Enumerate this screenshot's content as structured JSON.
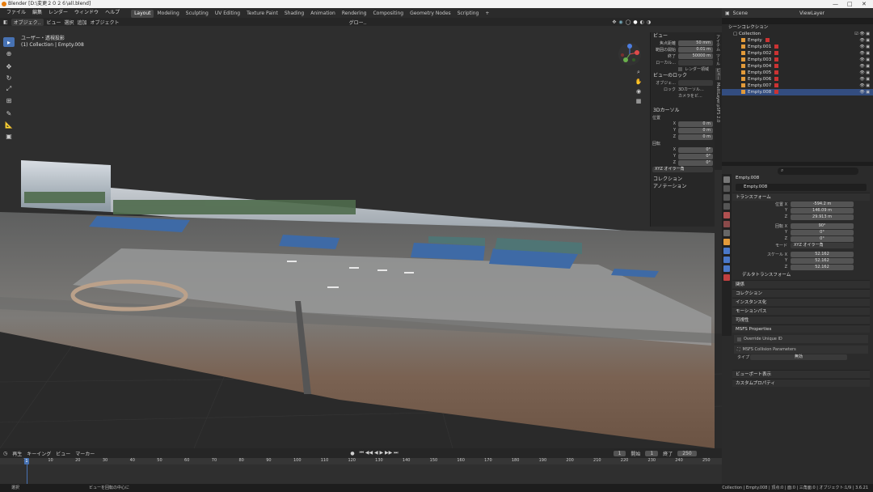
{
  "titlebar": {
    "title": "Blender [D:\\変更２０２６\\all.blend]",
    "min": "—",
    "max": "□",
    "close": "✕"
  },
  "menu": [
    "ファイル",
    "編集",
    "レンダー",
    "ウィンドウ",
    "ヘルプ"
  ],
  "workspaces": [
    {
      "label": "Layout",
      "active": true
    },
    {
      "label": "Modeling"
    },
    {
      "label": "Sculpting"
    },
    {
      "label": "UV Editing"
    },
    {
      "label": "Texture Paint"
    },
    {
      "label": "Shading"
    },
    {
      "label": "Animation"
    },
    {
      "label": "Rendering"
    },
    {
      "label": "Compositing"
    },
    {
      "label": "Geometry Nodes"
    },
    {
      "label": "Scripting"
    },
    {
      "label": "+"
    }
  ],
  "vpheader": {
    "mode": "オブジェク..",
    "items": [
      "ビュー",
      "選択",
      "追加",
      "オブジェクト"
    ],
    "transform": "グロー..",
    "options": "オプション"
  },
  "overlay": {
    "line1": "ユーザー・透視投影",
    "line2": "(1) Collection | Empty.008"
  },
  "npanel": {
    "view_header": "ビュー",
    "focal_label": "焦点距離",
    "focal": "50 mm",
    "clip_start_label": "範囲の開始",
    "clip_start": "0.01 m",
    "clip_end_label": "終了",
    "clip_end": "50000 m",
    "local_label": "ローカル...",
    "render_region": "レンダー領域",
    "lock_header": "ビューのロック",
    "object_label": "オブジェ...",
    "lock_label": "ロック",
    "lock_3d": "3Dカーソル...",
    "lock_cam": "カメラをビ...",
    "cursor_header": "3Dカーソル",
    "location_label": "位置",
    "rotation_label": "回転",
    "x": "X",
    "y": "Y",
    "z": "Z",
    "loc_x": "0 m",
    "loc_y": "0 m",
    "loc_z": "0 m",
    "rot_x": "0°",
    "rot_y": "0°",
    "rot_z": "0°",
    "rot_mode": "XYZ オイラー角",
    "collection": "コレクション",
    "annotation": "アノテーション"
  },
  "sidetabs": [
    "アイテム",
    "ツール",
    "ビュー",
    "MultiLayer.pSFS 2.0"
  ],
  "outliner": {
    "scene": "Scene",
    "viewlayer": "ViewLayer",
    "root": "シーンコレクション",
    "collection": "Collection",
    "items": [
      "Empty",
      "Empty.001",
      "Empty.002",
      "Empty.003",
      "Empty.004",
      "Empty.005",
      "Empty.006",
      "Empty.007",
      "Empty.008"
    ],
    "selected_index": 8
  },
  "props": {
    "object_name": "Empty.008",
    "object_field": "Empty.008",
    "transform": "トランスフォーム",
    "loc_label": "位置 X",
    "loc_x": "-594.2 m",
    "loc_y": "146.09 m",
    "loc_z": "29.913 m",
    "rot_label": "回転 X",
    "rot_x": "90°",
    "rot_y": "0°",
    "rot_z": "0°",
    "mode_label": "モード",
    "mode": "XYZ オイラー角",
    "scale_label": "スケール X",
    "scale_x": "52.162",
    "scale_y": "52.162",
    "scale_z": "52.162",
    "y": "Y",
    "z": "Z",
    "delta": "デルタトランスフォーム",
    "sections": [
      "関係",
      "コレクション",
      "インスタンス化",
      "モーションパス",
      "可視性"
    ],
    "msfs": "MSFS Properties",
    "override": "Override Unique ID",
    "collision": "MSFS Collision Parameters",
    "type_label": "タイプ",
    "type_value": "無効",
    "viewport_display": "ビューポート表示",
    "custom_props": "カスタムプロパティ"
  },
  "timeline": {
    "menu": [
      "再生",
      "キーイング",
      "ビュー",
      "マーカー"
    ],
    "current": "1",
    "start_label": "開始",
    "start": "1",
    "end_label": "終了",
    "end": "250",
    "ticks": [
      "1",
      "10",
      "20",
      "30",
      "40",
      "50",
      "60",
      "70",
      "80",
      "90",
      "100",
      "110",
      "120",
      "130",
      "140",
      "150",
      "160",
      "170",
      "180",
      "190",
      "200",
      "210",
      "220",
      "230",
      "240",
      "250"
    ]
  },
  "status": {
    "left": "選択",
    "middle": "ビューを回転の中心に",
    "right": "Collection | Empty.008 | 頂点:0 | 面:0 | 三角面:0 | オブジェクト:1/9 | 3.6.21"
  }
}
